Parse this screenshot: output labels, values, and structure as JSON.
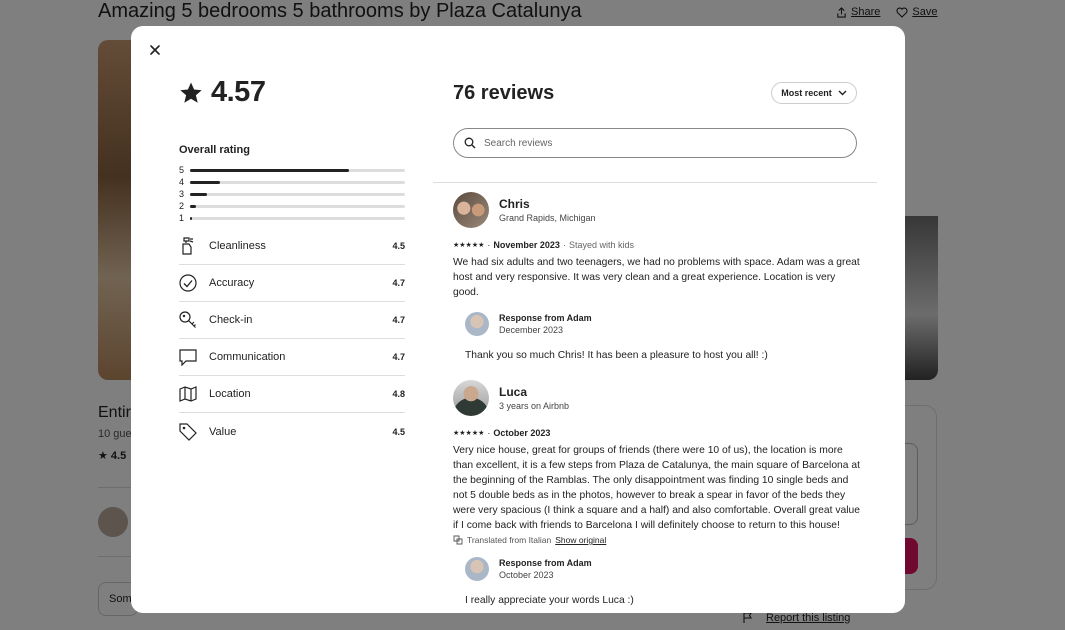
{
  "background": {
    "listing_title": "Amazing 5 bedrooms 5 bathrooms by Plaza Catalunya",
    "share_label": "Share",
    "save_label": "Save",
    "entire_partial": "Entir",
    "guests_partial": "10 gue",
    "rating_partial": "4.5",
    "some_partial": "Som",
    "report_label": "Report this listing"
  },
  "modal": {
    "overall_score": "4.57",
    "overall_rating_label": "Overall rating",
    "distribution": [
      {
        "star": "5",
        "fraction": 0.74
      },
      {
        "star": "4",
        "fraction": 0.14
      },
      {
        "star": "3",
        "fraction": 0.08
      },
      {
        "star": "2",
        "fraction": 0.03
      },
      {
        "star": "1",
        "fraction": 0.01
      }
    ],
    "categories": [
      {
        "name": "Cleanliness",
        "value": "4.5",
        "icon": "spray-bottle-icon"
      },
      {
        "name": "Accuracy",
        "value": "4.7",
        "icon": "check-circle-icon"
      },
      {
        "name": "Check-in",
        "value": "4.7",
        "icon": "key-icon"
      },
      {
        "name": "Communication",
        "value": "4.7",
        "icon": "chat-bubble-icon"
      },
      {
        "name": "Location",
        "value": "4.8",
        "icon": "map-icon"
      },
      {
        "name": "Value",
        "value": "4.5",
        "icon": "tag-icon"
      }
    ],
    "review_count": "76 reviews",
    "sort_label": "Most recent",
    "search_placeholder": "Search reviews",
    "reviews": [
      {
        "name": "Chris",
        "subtitle": "Grand Rapids, Michigan",
        "stars": "★★★★★",
        "date": "November 2023",
        "stay_type": "Stayed with kids",
        "text": "We had six adults and two teenagers, we had no problems with space. Adam was a great host and very responsive. It was very clean and a great experience. Location is very good.",
        "response": {
          "title": "Response from Adam",
          "date": "December 2023",
          "text": "Thank you so much Chris! It has been a pleasure to host you all! :)"
        }
      },
      {
        "name": "Luca",
        "subtitle": "3 years on Airbnb",
        "stars": "★★★★★",
        "date": "October 2023",
        "text": "Very nice house, great for groups of friends (there were 10 of us), the location is more than excellent, it is a few steps from Plaza de Catalunya, the main square of Barcelona at the beginning of the Ramblas. The only disappointment was finding 10 single beds and not 5 double beds as in the photos, however to break a spear in favor of the beds they were very spacious (I think a square and a half) and also comfortable. Overall great value if I come back with friends to Barcelona I will definitely choose to return to this house!",
        "translated_label": "Translated from Italian",
        "show_original_label": "Show original",
        "response": {
          "title": "Response from Adam",
          "date": "October 2023",
          "text": "I really appreciate your words Luca :)"
        }
      }
    ]
  }
}
